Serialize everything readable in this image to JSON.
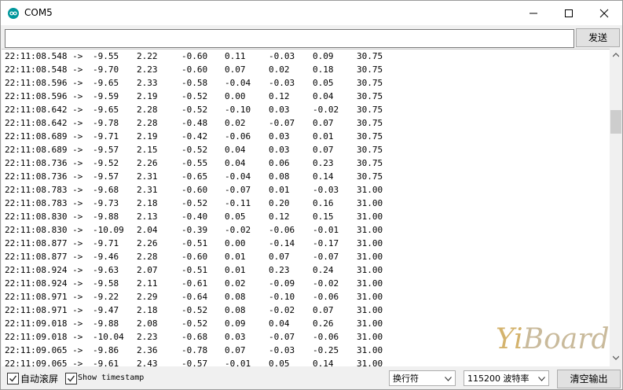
{
  "window": {
    "title": "COM5"
  },
  "input": {
    "value": "",
    "send_label": "发送"
  },
  "output": {
    "lines": [
      [
        "22:11:08.548 -> ",
        "-9.55",
        "2.22",
        "-0.60",
        "0.11",
        "-0.03",
        "0.09",
        "30.75"
      ],
      [
        "22:11:08.548 -> ",
        "-9.70",
        "2.23",
        "-0.60",
        "0.07",
        "0.02",
        "0.18",
        "30.75"
      ],
      [
        "22:11:08.596 -> ",
        "-9.65",
        "2.33",
        "-0.58",
        "-0.04",
        "-0.03",
        "0.05",
        "30.75"
      ],
      [
        "22:11:08.596 -> ",
        "-9.59",
        "2.19",
        "-0.52",
        "0.00",
        "0.12",
        "0.04",
        "30.75"
      ],
      [
        "22:11:08.642 -> ",
        "-9.65",
        "2.28",
        "-0.52",
        "-0.10",
        "0.03",
        "-0.02",
        "30.75"
      ],
      [
        "22:11:08.642 -> ",
        "-9.78",
        "2.28",
        "-0.48",
        "0.02",
        "-0.07",
        "0.07",
        "30.75"
      ],
      [
        "22:11:08.689 -> ",
        "-9.71",
        "2.19",
        "-0.42",
        "-0.06",
        "0.03",
        "0.01",
        "30.75"
      ],
      [
        "22:11:08.689 -> ",
        "-9.57",
        "2.15",
        "-0.52",
        "0.04",
        "0.03",
        "0.07",
        "30.75"
      ],
      [
        "22:11:08.736 -> ",
        "-9.52",
        "2.26",
        "-0.55",
        "0.04",
        "0.06",
        "0.23",
        "30.75"
      ],
      [
        "22:11:08.736 -> ",
        "-9.57",
        "2.31",
        "-0.65",
        "-0.04",
        "0.08",
        "0.14",
        "30.75"
      ],
      [
        "22:11:08.783 -> ",
        "-9.68",
        "2.31",
        "-0.60",
        "-0.07",
        "0.01",
        "-0.03",
        "31.00"
      ],
      [
        "22:11:08.783 -> ",
        "-9.73",
        "2.18",
        "-0.52",
        "-0.11",
        "0.20",
        "0.16",
        "31.00"
      ],
      [
        "22:11:08.830 -> ",
        "-9.88",
        "2.13",
        "-0.40",
        "0.05",
        "0.12",
        "0.15",
        "31.00"
      ],
      [
        "22:11:08.830 -> ",
        "-10.09",
        "2.04",
        "-0.39",
        "-0.02",
        "-0.06",
        "-0.01",
        "31.00"
      ],
      [
        "22:11:08.877 -> ",
        "-9.71",
        "2.26",
        "-0.51",
        "0.00",
        "-0.14",
        "-0.17",
        "31.00"
      ],
      [
        "22:11:08.877 -> ",
        "-9.46",
        "2.28",
        "-0.60",
        "0.01",
        "0.07",
        "-0.07",
        "31.00"
      ],
      [
        "22:11:08.924 -> ",
        "-9.63",
        "2.07",
        "-0.51",
        "0.01",
        "0.23",
        "0.24",
        "31.00"
      ],
      [
        "22:11:08.924 -> ",
        "-9.58",
        "2.11",
        "-0.61",
        "0.02",
        "-0.09",
        "-0.02",
        "31.00"
      ],
      [
        "22:11:08.971 -> ",
        "-9.22",
        "2.29",
        "-0.64",
        "0.08",
        "-0.10",
        "-0.06",
        "31.00"
      ],
      [
        "22:11:08.971 -> ",
        "-9.47",
        "2.18",
        "-0.52",
        "0.08",
        "-0.02",
        "0.07",
        "31.00"
      ],
      [
        "22:11:09.018 -> ",
        "-9.88",
        "2.08",
        "-0.52",
        "0.09",
        "0.04",
        "0.26",
        "31.00"
      ],
      [
        "22:11:09.018 -> ",
        "-10.04",
        "2.23",
        "-0.68",
        "0.03",
        "-0.07",
        "-0.06",
        "31.00"
      ],
      [
        "22:11:09.065 -> ",
        "-9.86",
        "2.36",
        "-0.78",
        "0.07",
        "-0.03",
        "-0.25",
        "31.00"
      ],
      [
        "22:11:09.065 -> ",
        "-9.61",
        "2.43",
        "-0.57",
        "-0.01",
        "0.05",
        "0.14",
        "31.00"
      ]
    ]
  },
  "watermark": {
    "text_a": "Yi",
    "text_b": "Board"
  },
  "bottom": {
    "autoscroll_label": "自动滚屏",
    "autoscroll_checked": true,
    "timestamp_label": "Show timestamp",
    "timestamp_checked": true,
    "line_ending": "换行符",
    "baud": "115200 波特率",
    "clear_label": "清空输出"
  },
  "colors": {
    "arduino_teal": "#00979c"
  }
}
